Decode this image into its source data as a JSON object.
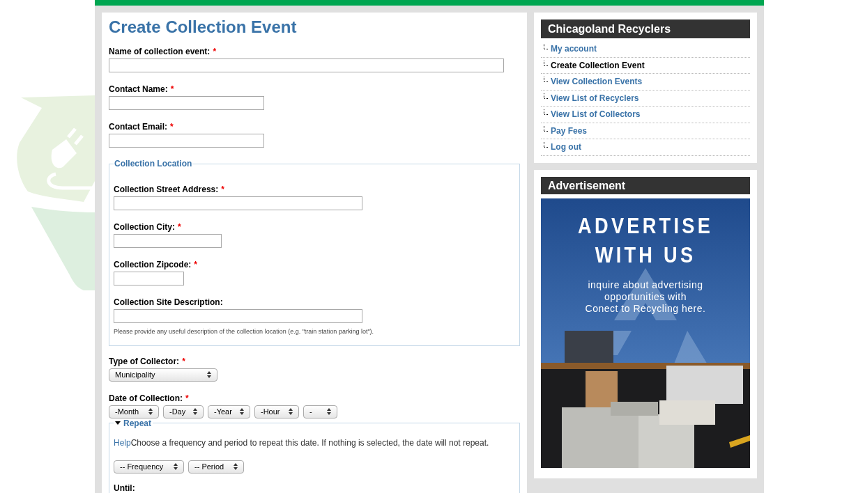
{
  "page_title": "Create Collection Event",
  "fields": [
    {
      "label": "Name of collection event:",
      "required_mark": "*"
    },
    {
      "label": "Contact Name:",
      "required_mark": "*"
    },
    {
      "label": "Contact Email:",
      "required_mark": "*"
    }
  ],
  "location": {
    "legend": "Collection Location",
    "fields": [
      {
        "label": "Collection Street Address:",
        "required_mark": "*"
      },
      {
        "label": "Collection City:",
        "required_mark": "*"
      },
      {
        "label": "Collection Zipcode:",
        "required_mark": "*"
      },
      {
        "label": "Collection Site Description:",
        "help": "Please provide any useful description of the collection location (e.g. \"train station parking lot\")."
      }
    ]
  },
  "collector": {
    "label": "Type of Collector:",
    "required_mark": "*",
    "value": "Municipality"
  },
  "date": {
    "label": "Date of Collection:",
    "required_mark": "*",
    "selects": [
      "-Month",
      "-Day",
      "-Year",
      "-Hour",
      "-"
    ]
  },
  "repeat": {
    "legend": "Repeat",
    "expanded": true,
    "help_link": "Help",
    "help_text": "Choose a frequency and period to repeat this date. If nothing is selected, the date will not repeat.",
    "selects": [
      "-- Frequency",
      "-- Period"
    ],
    "until_label": "Until:"
  },
  "sidebar": {
    "title": "Chicagoland Recyclers",
    "items": [
      {
        "label": "My account",
        "selected": false
      },
      {
        "label": "Create Collection Event",
        "selected": true
      },
      {
        "label": "View Collection Events",
        "selected": false
      },
      {
        "label": "View List of Recyclers",
        "selected": false
      },
      {
        "label": "View List of Collectors",
        "selected": false
      },
      {
        "label": "Pay Fees",
        "selected": false
      },
      {
        "label": "Log out",
        "selected": false
      }
    ]
  },
  "ad": {
    "title": "Advertisement",
    "headline": [
      "ADVERTISE",
      "WITH US"
    ],
    "body": [
      "inquire about advertising",
      "opportunities with",
      "Conect to Recycling here."
    ]
  }
}
